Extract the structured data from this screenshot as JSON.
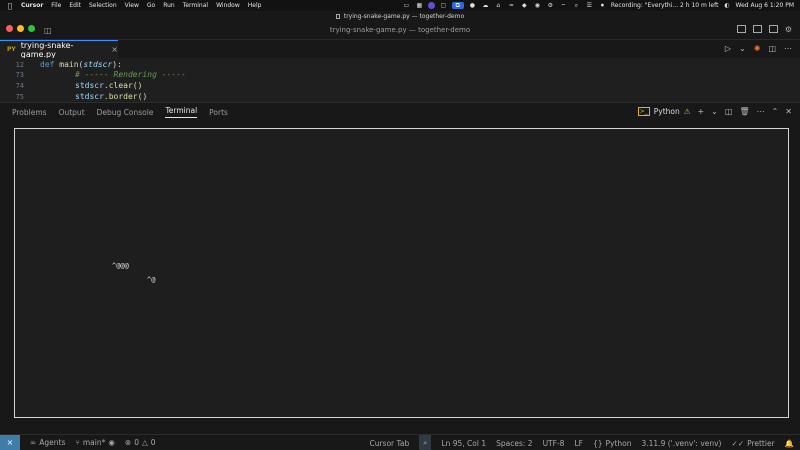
{
  "menubar": {
    "apple": "",
    "items": [
      "Cursor",
      "File",
      "Edit",
      "Selection",
      "View",
      "Go",
      "Run",
      "Terminal",
      "Window",
      "Help"
    ],
    "recording": "Recording: \"Everythi... 2 h 10 m left",
    "datetime": "Wed Aug 6  1:20 PM"
  },
  "titlebar": {
    "title": "trying-snake-game.py — together-demo"
  },
  "window": {
    "title": "trying-snake-game.py — together-demo"
  },
  "tab": {
    "label": "trying-snake-game.py",
    "icon_text": "PY",
    "close": "×"
  },
  "editor": {
    "lines": [
      {
        "num": "12",
        "kw": "def ",
        "fn": "main",
        "open": "(",
        "param": "stdscr",
        "close": "):"
      },
      {
        "num": "73",
        "comment": "# ----- Rendering -----"
      },
      {
        "num": "74",
        "var": "stdscr",
        "rest": ".clear()"
      },
      {
        "num": "75",
        "var": "stdscr",
        "rest": ".border()"
      }
    ]
  },
  "panel": {
    "tabs": [
      "Problems",
      "Output",
      "Debug Console",
      "Terminal",
      "Ports"
    ],
    "active_tab": "Terminal",
    "terminal_label": "Python",
    "term_icon": ">_"
  },
  "terminal": {
    "snake": "^@@@",
    "food": "^@"
  },
  "statusbar": {
    "remote_icon": "⨯",
    "agents": "Agents",
    "branch": "main*",
    "errors": "0",
    "warnings": "0",
    "cursor_tab": "Cursor Tab",
    "position": "Ln 95, Col 1",
    "spaces": "Spaces: 2",
    "encoding": "UTF-8",
    "eol": "LF",
    "language": "Python",
    "interpreter": "3.11.9 ('.venv': venv)",
    "prettier": "Prettier"
  },
  "colors": {
    "accent": "#3794ff",
    "remote": "#3e7ea8",
    "warning": "#e8a83c",
    "close_red": "#ff5f57",
    "minimize_yellow": "#febc2e",
    "zoom_green": "#28c840"
  }
}
